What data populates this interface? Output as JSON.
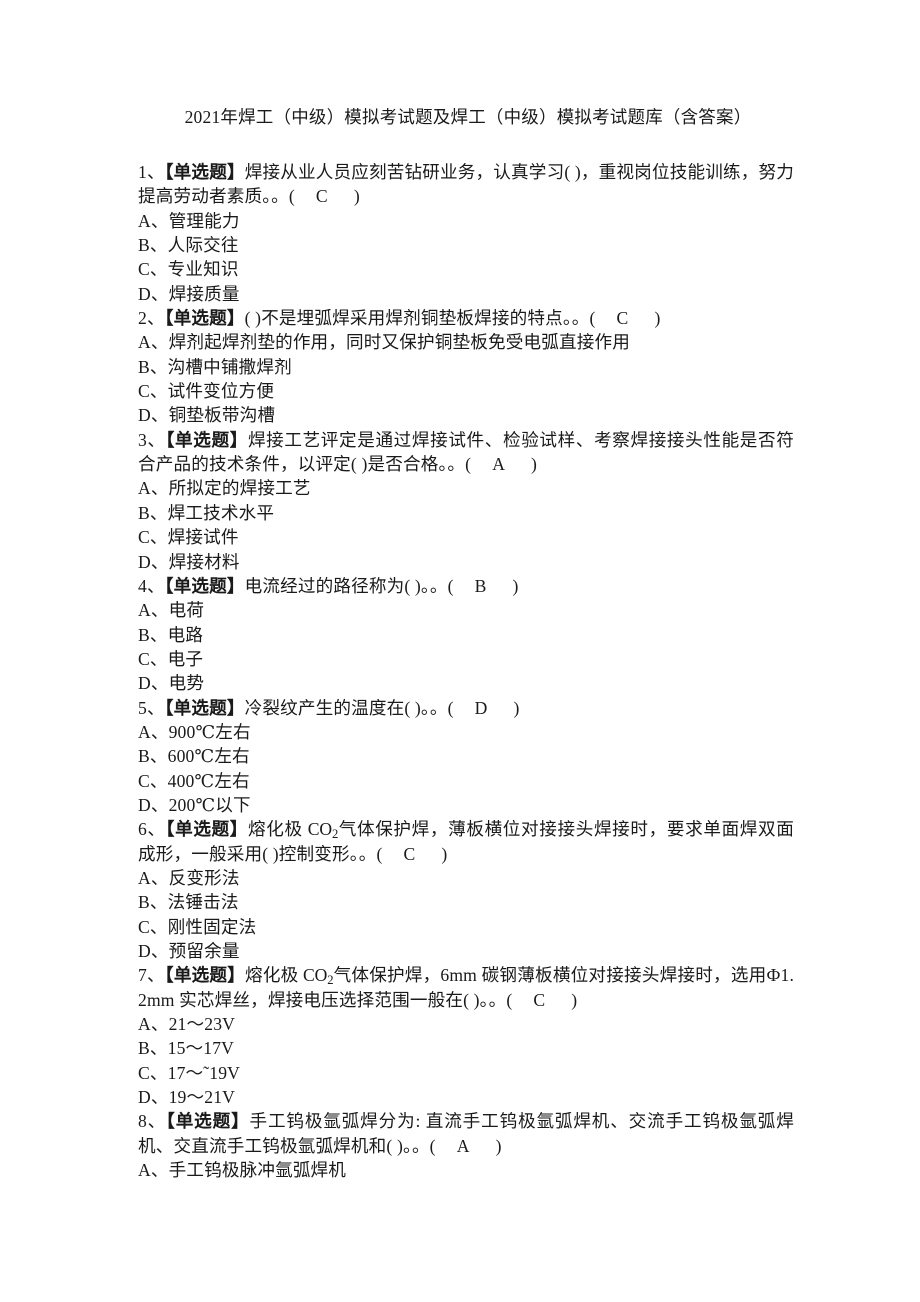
{
  "document": {
    "title": "2021年焊工（中级）模拟考试题及焊工（中级）模拟考试题库（含答案）",
    "page_background": "#ffffff",
    "text_color": "#1a1a1a"
  },
  "labels": {
    "single_choice": "【单选题】",
    "open_paren": "（",
    "close_paren": "）",
    "blank": "( )"
  },
  "questions": [
    {
      "number": "1、",
      "tag": "【单选题】",
      "stem_before": "焊接从业人员应刻苦钻研业务，认真学习( )，重视岗位技能训练，努力提高劳动者素质。",
      "answer": "C",
      "options": [
        {
          "key": "A、",
          "text": "管理能力"
        },
        {
          "key": "B、",
          "text": "人际交往"
        },
        {
          "key": "C、",
          "text": "专业知识"
        },
        {
          "key": "D、",
          "text": "焊接质量"
        }
      ]
    },
    {
      "number": "2、",
      "tag": "【单选题】",
      "stem_before": "( )不是埋弧焊采用焊剂铜垫板焊接的特点。",
      "answer": "C",
      "options": [
        {
          "key": "A、",
          "text": "焊剂起焊剂垫的作用，同时又保护铜垫板免受电弧直接作用"
        },
        {
          "key": "B、",
          "text": "沟槽中铺撒焊剂"
        },
        {
          "key": "C、",
          "text": "试件变位方便"
        },
        {
          "key": "D、",
          "text": "铜垫板带沟槽"
        }
      ]
    },
    {
      "number": "3、",
      "tag": "【单选题】",
      "stem_before": "焊接工艺评定是通过焊接试件、检验试样、考察焊接接头性能是否符合产品的技术条件，以评定( )是否合格。",
      "answer": "A",
      "options": [
        {
          "key": "A、",
          "text": "所拟定的焊接工艺"
        },
        {
          "key": "B、",
          "text": "焊工技术水平"
        },
        {
          "key": "C、",
          "text": "焊接试件"
        },
        {
          "key": "D、",
          "text": "焊接材料"
        }
      ]
    },
    {
      "number": "4、",
      "tag": "【单选题】",
      "stem_before": "电流经过的路径称为( )。",
      "answer": "B",
      "options": [
        {
          "key": "A、",
          "text": "电荷"
        },
        {
          "key": "B、",
          "text": "电路"
        },
        {
          "key": "C、",
          "text": "电子"
        },
        {
          "key": "D、",
          "text": "电势"
        }
      ]
    },
    {
      "number": "5、",
      "tag": "【单选题】",
      "stem_before": "冷裂纹产生的温度在( )。",
      "answer": "D",
      "options": [
        {
          "key": "A、",
          "text": "900℃左右"
        },
        {
          "key": "B、",
          "text": "600℃左右"
        },
        {
          "key": "C、",
          "text": "400℃左右"
        },
        {
          "key": "D、",
          "text": "200℃以下"
        }
      ]
    },
    {
      "number": "6、",
      "tag": "【单选题】",
      "stem_parts": [
        {
          "type": "text",
          "value": "熔化极 "
        },
        {
          "type": "formula",
          "value": "CO",
          "sub": "2"
        },
        {
          "type": "text",
          "value": "气体保护焊，薄板横位对接接头焊接时，要求单面焊双面成形，一般采用( )控制变形。"
        }
      ],
      "answer": "C",
      "options": [
        {
          "key": "A、",
          "text": "反变形法"
        },
        {
          "key": "B、",
          "text": "法锤击法"
        },
        {
          "key": "C、",
          "text": "刚性固定法"
        },
        {
          "key": "D、",
          "text": "预留余量"
        }
      ]
    },
    {
      "number": "7、",
      "tag": "【单选题】",
      "stem_parts": [
        {
          "type": "text",
          "value": "熔化极 "
        },
        {
          "type": "formula",
          "value": "CO",
          "sub": "2"
        },
        {
          "type": "text",
          "value": "气体保护焊，6mm 碳钢薄板横位对接接头焊接时，选用Ф1.2mm 实芯焊丝，焊接电压选择范围一般在( )。"
        }
      ],
      "answer": "C",
      "options": [
        {
          "key": "A、",
          "text": "21～23V"
        },
        {
          "key": "B、",
          "text": "15～17V"
        },
        {
          "key": "C、",
          "text": "17～˜19V"
        },
        {
          "key": "D、",
          "text": "19～21V"
        }
      ]
    },
    {
      "number": "8、",
      "tag": "【单选题】",
      "stem_before": "手工钨极氩弧焊分为: 直流手工钨极氩弧焊机、交流手工钨极氩弧焊机、交直流手工钨极氩弧焊机和( )。",
      "answer": "A",
      "options": [
        {
          "key": "A、",
          "text": "手工钨极脉冲氩弧焊机"
        }
      ]
    }
  ]
}
